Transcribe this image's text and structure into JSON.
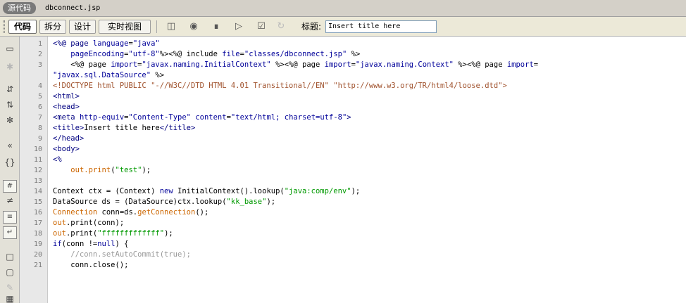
{
  "tab_bar": {
    "source_tab": "源代码",
    "file_name": "dbconnect.jsp"
  },
  "toolbar": {
    "views": [
      {
        "label": "代码",
        "active": true
      },
      {
        "label": "拆分",
        "active": false
      },
      {
        "label": "设计",
        "active": false
      },
      {
        "label": "实时视图",
        "active": false
      }
    ],
    "icons": [
      "live-code-icon",
      "inspect-icon",
      "multiscreen-icon",
      "preview-icon",
      "validate-icon",
      "refresh-icon"
    ],
    "title_label": "标题:",
    "title_value": "Insert title here"
  },
  "side_toolbar_icons": [
    "open-documents-icon",
    "show-code-navigator-icon",
    "collapse-full-tag-icon",
    "collapse-selection-icon",
    "expand-all-icon",
    "select-parent-tag-icon",
    "balance-braces-icon",
    "line-numbers-icon",
    "highlight-invalid-icon",
    "syntax-coloring-icon",
    "word-wrap-icon",
    "apply-comment-icon",
    "remove-comment-icon",
    "wrap-tag-icon",
    "recent-snippets-icon"
  ],
  "editor": {
    "line_numbers": [
      "1",
      "2",
      "3",
      "",
      "4",
      "5",
      "6",
      "7",
      "8",
      "9",
      "10",
      "11",
      "12",
      "13",
      "14",
      "15",
      "16",
      "17",
      "18",
      "19",
      "20",
      "21"
    ],
    "lines": [
      [
        {
          "cls": "t",
          "text": "<%@ page "
        },
        {
          "cls": "k",
          "text": "language"
        },
        {
          "cls": "n",
          "text": "="
        },
        {
          "cls": "k",
          "text": "\"java\""
        }
      ],
      [
        {
          "cls": "n",
          "text": "    "
        },
        {
          "cls": "k",
          "text": "pageEncoding"
        },
        {
          "cls": "n",
          "text": "="
        },
        {
          "cls": "k",
          "text": "\"utf-8\""
        },
        {
          "cls": "n",
          "text": "%><%@ include "
        },
        {
          "cls": "k",
          "text": "file"
        },
        {
          "cls": "n",
          "text": "="
        },
        {
          "cls": "k",
          "text": "\"classes/dbconnect.jsp\""
        },
        {
          "cls": "n",
          "text": " %>"
        }
      ],
      [
        {
          "cls": "n",
          "text": "    <%@ page "
        },
        {
          "cls": "k",
          "text": "import"
        },
        {
          "cls": "n",
          "text": "="
        },
        {
          "cls": "k",
          "text": "\"javax.naming.InitialContext\""
        },
        {
          "cls": "n",
          "text": " %><%@ page "
        },
        {
          "cls": "k",
          "text": "import"
        },
        {
          "cls": "n",
          "text": "="
        },
        {
          "cls": "k",
          "text": "\"javax.naming.Context\""
        },
        {
          "cls": "n",
          "text": " %><%@ page "
        },
        {
          "cls": "k",
          "text": "import"
        },
        {
          "cls": "n",
          "text": "="
        }
      ],
      [
        {
          "cls": "k",
          "text": "\"javax.sql.DataSource\""
        },
        {
          "cls": "n",
          "text": " %>"
        }
      ],
      [
        {
          "cls": "d",
          "text": "<!DOCTYPE html PUBLIC \"-//W3C//DTD HTML 4.01 Transitional//EN\" \"http://www.w3.org/TR/html4/loose.dtd\">"
        }
      ],
      [
        {
          "cls": "t",
          "text": "<html>"
        }
      ],
      [
        {
          "cls": "t",
          "text": "<head>"
        }
      ],
      [
        {
          "cls": "t",
          "text": "<meta "
        },
        {
          "cls": "k",
          "text": "http-equiv"
        },
        {
          "cls": "n",
          "text": "="
        },
        {
          "cls": "k",
          "text": "\"Content-Type\""
        },
        {
          "cls": "n",
          "text": " "
        },
        {
          "cls": "k",
          "text": "content"
        },
        {
          "cls": "n",
          "text": "="
        },
        {
          "cls": "k",
          "text": "\"text/html; charset=utf-8\""
        },
        {
          "cls": "t",
          "text": ">"
        }
      ],
      [
        {
          "cls": "t",
          "text": "<title>"
        },
        {
          "cls": "n",
          "text": "Insert title here"
        },
        {
          "cls": "t",
          "text": "</title>"
        }
      ],
      [
        {
          "cls": "t",
          "text": "</head>"
        }
      ],
      [
        {
          "cls": "t",
          "text": "<body>"
        }
      ],
      [
        {
          "cls": "t",
          "text": "<%"
        }
      ],
      [
        {
          "cls": "n",
          "text": "    "
        },
        {
          "cls": "m",
          "text": "out.print"
        },
        {
          "cls": "n",
          "text": "("
        },
        {
          "cls": "s",
          "text": "\"test\""
        },
        {
          "cls": "n",
          "text": ");"
        }
      ],
      [
        {
          "cls": "n",
          "text": ""
        }
      ],
      [
        {
          "cls": "n",
          "text": "Context ctx = (Context) "
        },
        {
          "cls": "k",
          "text": "new"
        },
        {
          "cls": "n",
          "text": " InitialContext().lookup("
        },
        {
          "cls": "s",
          "text": "\"java:comp/env\""
        },
        {
          "cls": "n",
          "text": ");"
        }
      ],
      [
        {
          "cls": "n",
          "text": "DataSource ds = (DataSource)ctx.lookup("
        },
        {
          "cls": "s",
          "text": "\"kk_base\""
        },
        {
          "cls": "n",
          "text": ");"
        }
      ],
      [
        {
          "cls": "m",
          "text": "Connection"
        },
        {
          "cls": "n",
          "text": " conn=ds."
        },
        {
          "cls": "m",
          "text": "getConnection"
        },
        {
          "cls": "n",
          "text": "();"
        }
      ],
      [
        {
          "cls": "m",
          "text": "out"
        },
        {
          "cls": "n",
          "text": ".print(conn);"
        }
      ],
      [
        {
          "cls": "m",
          "text": "out"
        },
        {
          "cls": "n",
          "text": ".print("
        },
        {
          "cls": "s",
          "text": "\"fffffffffffff\""
        },
        {
          "cls": "n",
          "text": ");"
        }
      ],
      [
        {
          "cls": "k",
          "text": "if"
        },
        {
          "cls": "n",
          "text": "(conn !="
        },
        {
          "cls": "k",
          "text": "null"
        },
        {
          "cls": "n",
          "text": ") {"
        }
      ],
      [
        {
          "cls": "c",
          "text": "    //conn.setAutoCommit(true);"
        }
      ],
      [
        {
          "cls": "n",
          "text": "    conn.close();"
        }
      ]
    ]
  }
}
